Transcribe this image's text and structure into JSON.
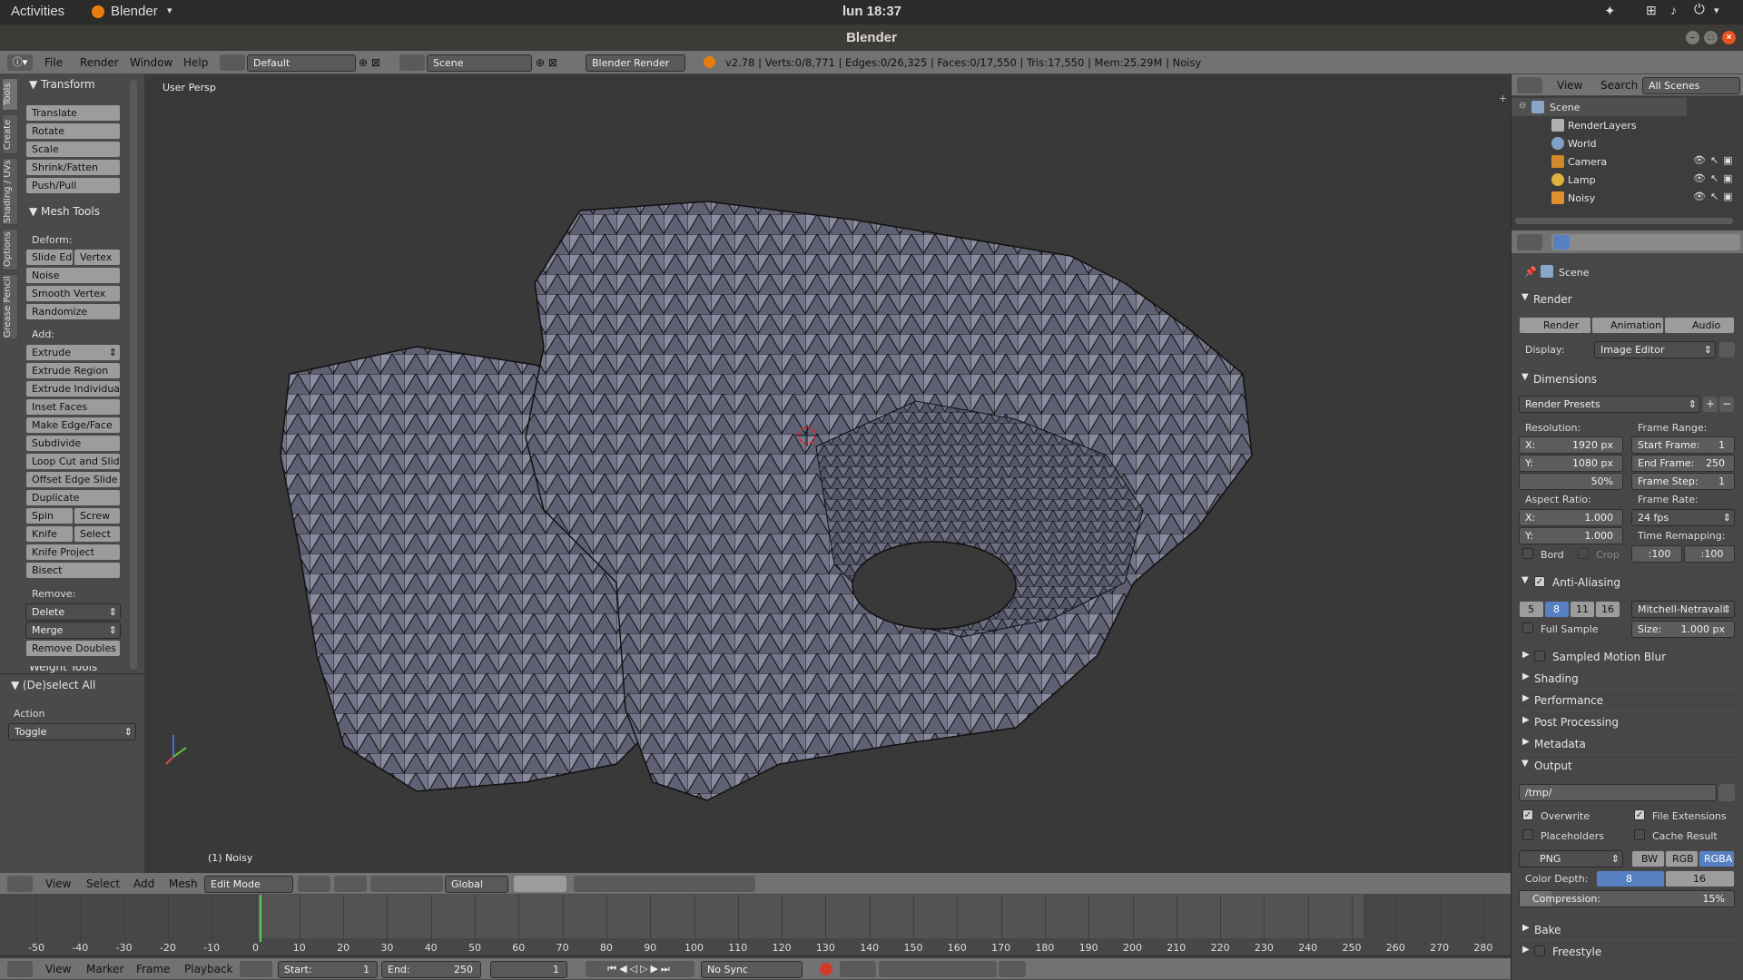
{
  "os": {
    "activities": "Activities",
    "app": "Blender",
    "clock": "lun 18:37"
  },
  "window": {
    "title": "Blender"
  },
  "info": {
    "menus": [
      "File",
      "Render",
      "Window",
      "Help"
    ],
    "layout": "Default",
    "scene": "Scene",
    "engine": "Blender Render",
    "stats": "v2.78 | Verts:0/8,771 | Edges:0/26,325 | Faces:0/17,550 | Tris:17,550 | Mem:25.29M | Noisy"
  },
  "tool_tabs": [
    "Tools",
    "Create",
    "Shading / UVs",
    "Options",
    "Grease Pencil"
  ],
  "tools": {
    "transform_title": "Transform",
    "transform": [
      "Translate",
      "Rotate",
      "Scale",
      "Shrink/Fatten",
      "Push/Pull"
    ],
    "mesh_title": "Mesh Tools",
    "deform_label": "Deform:",
    "slide_edge": "Slide Ed",
    "vertex": "Vertex",
    "deform": [
      "Noise",
      "Smooth Vertex",
      "Randomize"
    ],
    "add_label": "Add:",
    "extrude": "Extrude",
    "add": [
      "Extrude Region",
      "Extrude Individual",
      "Inset Faces",
      "Make Edge/Face",
      "Subdivide",
      "Loop Cut and Slide",
      "Offset Edge Slide",
      "Duplicate"
    ],
    "spin": "Spin",
    "screw": "Screw",
    "knife": "Knife",
    "select": "Select",
    "add2": [
      "Knife Project",
      "Bisect"
    ],
    "remove_label": "Remove:",
    "delete": "Delete",
    "merge": "Merge",
    "remove_doubles": "Remove Doubles",
    "weight_tools": "Weight Tools",
    "op_title": "(De)select All",
    "action_label": "Action",
    "action_value": "Toggle"
  },
  "viewport": {
    "persp": "User Persp",
    "object": "(1) Noisy"
  },
  "view3d_header": {
    "menus": [
      "View",
      "Select",
      "Add",
      "Mesh"
    ],
    "mode": "Edit Mode",
    "orientation": "Global"
  },
  "timeline": {
    "ticks": [
      "-50",
      "-40",
      "-30",
      "-20",
      "-10",
      "0",
      "10",
      "20",
      "30",
      "40",
      "50",
      "60",
      "70",
      "80",
      "90",
      "100",
      "110",
      "120",
      "130",
      "140",
      "150",
      "160",
      "170",
      "180",
      "190",
      "200",
      "210",
      "220",
      "230",
      "240",
      "250",
      "260",
      "270",
      "280"
    ],
    "menus": [
      "View",
      "Marker",
      "Frame",
      "Playback"
    ],
    "start_label": "Start:",
    "start": "1",
    "end_label": "End:",
    "end": "250",
    "current": "1",
    "sync": "No Sync"
  },
  "outliner": {
    "menus": [
      "View",
      "Search"
    ],
    "filter": "All Scenes",
    "items": [
      "Scene",
      "RenderLayers",
      "World",
      "Camera",
      "Lamp",
      "Noisy"
    ]
  },
  "properties": {
    "context": "Scene",
    "render_title": "Render",
    "render_btn": "Render",
    "animation_btn": "Animation",
    "audio_btn": "Audio",
    "display_label": "Display:",
    "display_value": "Image Editor",
    "dimensions_title": "Dimensions",
    "presets": "Render Presets",
    "resolution_label": "Resolution:",
    "res_x_label": "X:",
    "res_x": "1920 px",
    "res_y_label": "Y:",
    "res_y": "1080 px",
    "res_pct": "50%",
    "frame_range_label": "Frame Range:",
    "start_frame_label": "Start Frame:",
    "start_frame": "1",
    "end_frame_label": "End Frame:",
    "end_frame": "250",
    "frame_step_label": "Frame Step:",
    "frame_step": "1",
    "aspect_label": "Aspect Ratio:",
    "asp_x_label": "X:",
    "asp_x": "1.000",
    "asp_y_label": "Y:",
    "asp_y": "1.000",
    "frame_rate_label": "Frame Rate:",
    "fps": "24 fps",
    "bord": "Bord",
    "crop": "Crop",
    "time_remap_label": "Time Remapping:",
    "remap_old": ":100",
    "remap_new": ":100",
    "aa_title": "Anti-Aliasing",
    "aa_samples": [
      "5",
      "8",
      "11",
      "16"
    ],
    "aa_filter": "Mitchell-Netravali",
    "full_sample": "Full Sample",
    "aa_size_label": "Size:",
    "aa_size": "1.000 px",
    "collapsed": [
      "Sampled Motion Blur",
      "Shading",
      "Performance",
      "Post Processing",
      "Metadata"
    ],
    "output_title": "Output",
    "output_path": "/tmp/",
    "overwrite": "Overwrite",
    "file_ext": "File Extensions",
    "placeholders": "Placeholders",
    "cache_result": "Cache Result",
    "format": "PNG",
    "bw": "BW",
    "rgb": "RGB",
    "rgba": "RGBA",
    "color_depth_label": "Color Depth:",
    "depth_8": "8",
    "depth_16": "16",
    "compression_label": "Compression:",
    "compression": "15%",
    "bake": "Bake",
    "freestyle": "Freestyle"
  },
  "colors": {
    "accent": "#5680c2",
    "selected": "#5680c2",
    "mesh": "#7c7d90",
    "bg": "#393939"
  }
}
